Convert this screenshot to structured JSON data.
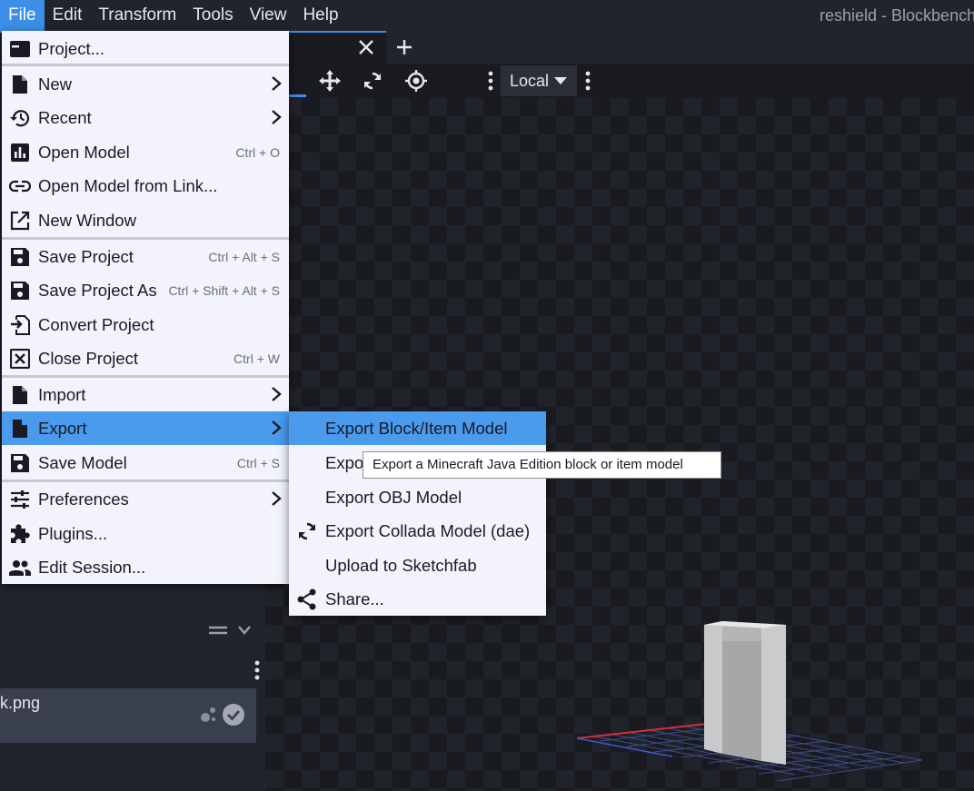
{
  "window": {
    "title": "reshield - Blockbench"
  },
  "menubar": {
    "items": [
      "File",
      "Edit",
      "Transform",
      "Tools",
      "View",
      "Help"
    ]
  },
  "toolbar": {
    "space_select": "Local"
  },
  "file_menu": {
    "items": [
      {
        "label": "Project...",
        "icon": "project-icon"
      },
      {
        "label": "New",
        "icon": "file-icon",
        "submenu": true
      },
      {
        "label": "Recent",
        "icon": "history-icon",
        "submenu": true
      },
      {
        "label": "Open Model",
        "icon": "chart-icon",
        "shortcut": "Ctrl + O"
      },
      {
        "label": "Open Model from Link...",
        "icon": "link-icon"
      },
      {
        "label": "New Window",
        "icon": "open-in-new-icon"
      },
      {
        "label": "Save Project",
        "icon": "save-icon",
        "shortcut": "Ctrl + Alt + S"
      },
      {
        "label": "Save Project As",
        "icon": "save-icon",
        "shortcut": "Ctrl + Shift + Alt + S"
      },
      {
        "label": "Convert Project",
        "icon": "convert-icon"
      },
      {
        "label": "Close Project",
        "icon": "close-box-icon",
        "shortcut": "Ctrl + W"
      },
      {
        "label": "Import",
        "icon": "file-icon",
        "submenu": true
      },
      {
        "label": "Export",
        "icon": "file-icon",
        "submenu": true
      },
      {
        "label": "Save Model",
        "icon": "save-icon",
        "shortcut": "Ctrl + S"
      },
      {
        "label": "Preferences",
        "icon": "tune-icon",
        "submenu": true
      },
      {
        "label": "Plugins...",
        "icon": "puzzle-icon"
      },
      {
        "label": "Edit Session...",
        "icon": "people-icon"
      }
    ]
  },
  "export_menu": {
    "items": [
      {
        "label": "Export Block/Item Model"
      },
      {
        "label": "Expo"
      },
      {
        "label": "Export OBJ Model"
      },
      {
        "label": "Export Collada Model (dae)",
        "icon": "sync-icon"
      },
      {
        "label": "Upload to Sketchfab"
      },
      {
        "label": "Share...",
        "icon": "share-icon"
      }
    ]
  },
  "tooltip": {
    "text": "Export a Minecraft Java Edition block or item model"
  },
  "left_panel": {
    "texture_name": "k.png"
  },
  "colors": {
    "accent": "#3c8ee6",
    "menu_bg": "#f2f3fb",
    "app_bg": "#21242c"
  }
}
